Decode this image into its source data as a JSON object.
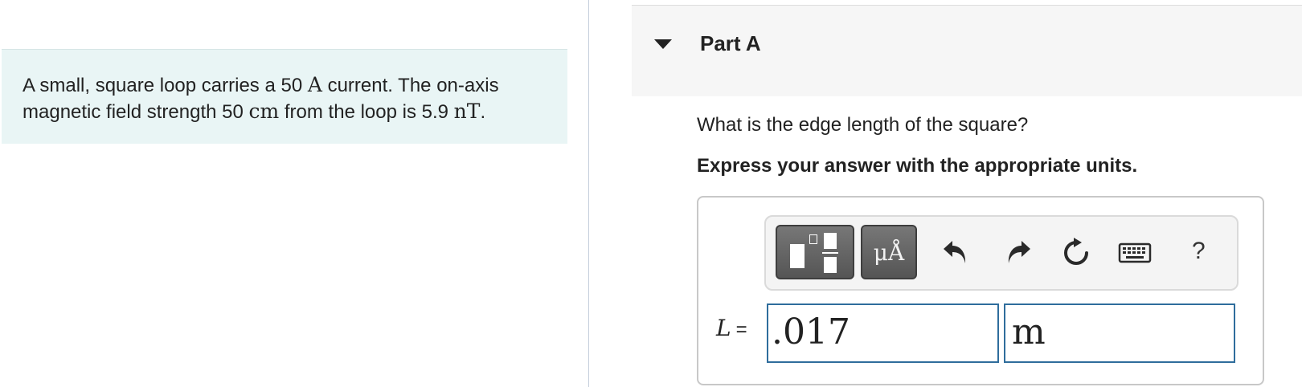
{
  "problem": {
    "text_1": "A small, square loop carries a 50 ",
    "current_unit": "A",
    "text_2": " current. The on-axis magnetic field strength 50 ",
    "distance_unit": "cm",
    "text_3": " from the loop is 5.9 ",
    "field_unit": "nT",
    "text_4": "."
  },
  "part": {
    "title": "Part A",
    "question": "What is the edge length of the square?",
    "instruction": "Express your answer with the appropriate units."
  },
  "toolbar": {
    "templates_icon": "templates-icon",
    "symbols_label": "μÅ",
    "undo_icon": "undo-icon",
    "redo_icon": "redo-icon",
    "reset_icon": "reset-icon",
    "keyboard_icon": "keyboard-icon",
    "help_label": "?"
  },
  "answer": {
    "variable": "L",
    "equals": "=",
    "value": ".017",
    "unit": "m"
  },
  "colors": {
    "problem_background": "#e9f5f5",
    "field_border": "#2f6d9c",
    "toolbar_button": "#666666"
  }
}
